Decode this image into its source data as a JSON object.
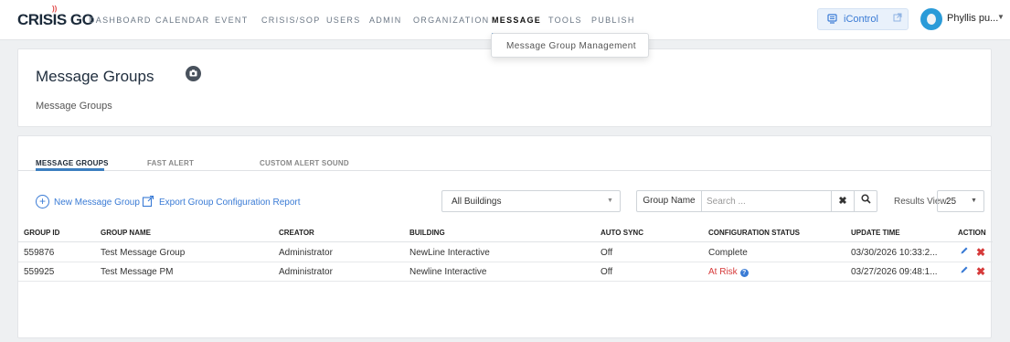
{
  "brand": {
    "logo_text": "CRISIS GO",
    "logo_mark": "))"
  },
  "nav": {
    "items": [
      {
        "label": "DASHBOARD"
      },
      {
        "label": "CALENDAR"
      },
      {
        "label": "EVENT"
      },
      {
        "label": "CRISIS/SOP"
      },
      {
        "label": "USERS"
      },
      {
        "label": "ADMIN"
      },
      {
        "label": "ORGANIZATION"
      },
      {
        "label": "MESSAGE",
        "active": true
      },
      {
        "label": "TOOLS"
      },
      {
        "label": "PUBLISH"
      }
    ],
    "dropdown_item": "Message Group Management",
    "icontrol_label": "iControl",
    "user_name": "Phyllis pu..."
  },
  "header": {
    "title": "Message Groups",
    "subtitle": "Message Groups"
  },
  "tabs": [
    {
      "label": "MESSAGE GROUPS",
      "active": true
    },
    {
      "label": "FAST ALERT"
    },
    {
      "label": "CUSTOM ALERT SOUND"
    }
  ],
  "toolbar": {
    "new_group_label": "New Message Group",
    "export_label": "Export Group Configuration Report",
    "building_select": "All Buildings",
    "search_label": "Group Name",
    "search_placeholder": "Search ...",
    "results_label": "Results View:",
    "results_value": "25"
  },
  "table": {
    "headers": [
      "GROUP ID",
      "GROUP NAME",
      "CREATOR",
      "BUILDING",
      "AUTO SYNC",
      "CONFIGURATION STATUS",
      "UPDATE TIME",
      "ACTION"
    ],
    "rows": [
      {
        "group_id": "559876",
        "group_name": "Test Message Group",
        "creator": "Administrator",
        "building": "NewLine Interactive",
        "auto_sync": "Off",
        "status": "Complete",
        "update_time": "03/30/2026 10:33:2..."
      },
      {
        "group_id": "559925",
        "group_name": "Test Message PM",
        "creator": "Administrator",
        "building": "Newline Interactive",
        "auto_sync": "Off",
        "status": "At Risk",
        "update_time": "03/27/2026 09:48:1..."
      }
    ]
  },
  "colors": {
    "accent": "#3a7bd5",
    "danger": "#d63b3b",
    "nav_underline": "#3c7fc0"
  },
  "icons": [
    "signal-wave-icon",
    "monitor-icon",
    "external-link-icon",
    "avatar",
    "caret-down-icon",
    "camera-icon",
    "plus-circle-icon",
    "export-icon",
    "clear-icon",
    "search-icon",
    "info-icon",
    "edit-icon",
    "delete-icon"
  ]
}
